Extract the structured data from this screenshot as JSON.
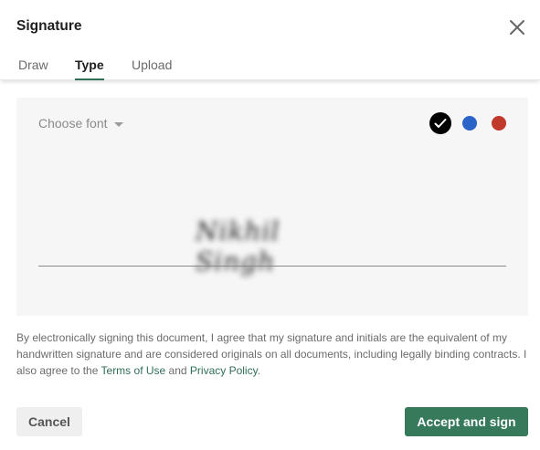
{
  "dialog": {
    "title": "Signature",
    "close_icon": "close-icon"
  },
  "tabs": [
    {
      "label": "Draw",
      "active": false
    },
    {
      "label": "Type",
      "active": true
    },
    {
      "label": "Upload",
      "active": false
    }
  ],
  "panel": {
    "font_placeholder": "Choose font",
    "colors": [
      {
        "name": "black",
        "hex": "#000000",
        "selected": true
      },
      {
        "name": "blue",
        "hex": "#2b64c9",
        "selected": false
      },
      {
        "name": "red",
        "hex": "#c0392b",
        "selected": false
      }
    ],
    "signature_text": "Nikhil Singh"
  },
  "legal": {
    "text_before": "By electronically signing this document, I agree that my signature and initials are the equivalent of my handwritten signature and are considered originals on all documents, including legally binding contracts. I also agree to the ",
    "terms_link": "Terms of Use",
    "conjunction": " and ",
    "privacy_link": "Privacy Policy",
    "text_after": "."
  },
  "buttons": {
    "cancel": "Cancel",
    "accept": "Accept and sign"
  },
  "colors": {
    "accent": "#367a5b",
    "link": "#2f6f55"
  }
}
